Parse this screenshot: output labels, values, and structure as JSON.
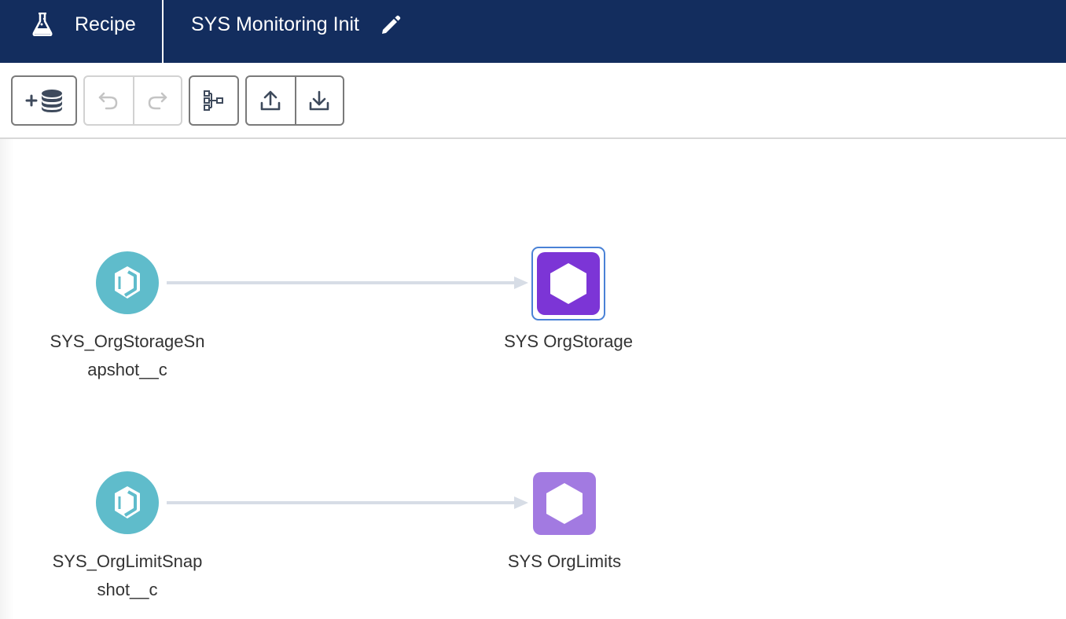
{
  "header": {
    "app_tab_label": "Recipe",
    "recipe_title": "SYS Monitoring Init"
  },
  "toolbar": {
    "add_data": "add-data",
    "undo": "undo",
    "redo": "redo",
    "graph_view": "graph-view",
    "upload": "upload",
    "download": "download"
  },
  "canvas": {
    "nodes": [
      {
        "kind": "source",
        "label_line1": "SYS_OrgStorageSn",
        "label_line2": "apshot__c"
      },
      {
        "kind": "output",
        "label": "SYS OrgStorage"
      },
      {
        "kind": "source",
        "label_line1": "SYS_OrgLimitSnap",
        "label_line2": "shot__c"
      },
      {
        "kind": "output",
        "label": "SYS OrgLimits"
      }
    ]
  },
  "colors": {
    "header_bg": "#132d5e",
    "source_node": "#5fbccb",
    "output_selected": "#7c35d6",
    "output_default": "#a27ae1",
    "edge": "#d7dde6",
    "selection": "#4a82d6"
  },
  "icons": {
    "header": [
      "flask-icon",
      "pencil-icon"
    ],
    "toolbar": [
      "add-database-icon",
      "undo-icon",
      "redo-icon",
      "hierarchy-icon",
      "upload-icon",
      "download-icon"
    ],
    "nodes": [
      "source-object-icon",
      "dataset-hexagon-icon"
    ]
  }
}
